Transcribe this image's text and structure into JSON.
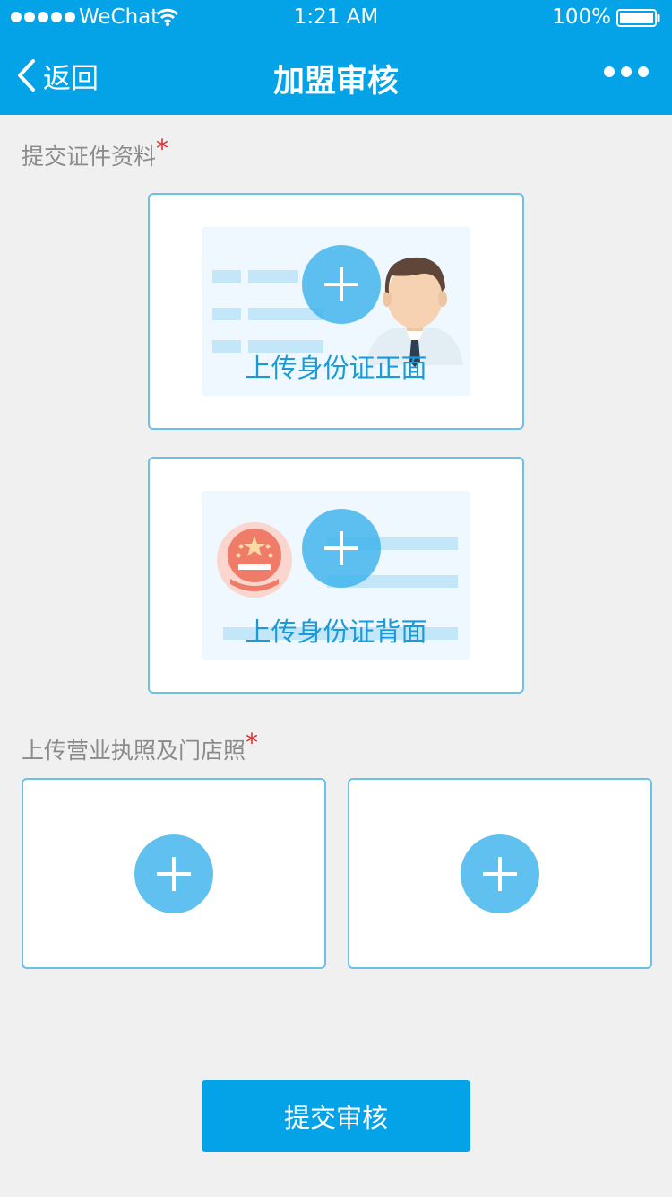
{
  "status_bar": {
    "carrier": "WeChat",
    "time": "1:21 AM",
    "battery": "100%"
  },
  "nav": {
    "back_label": "返回",
    "title": "加盟审核"
  },
  "id_section": {
    "label": "提交证件资料",
    "required_mark": "*",
    "front_caption": "上传身份证正面",
    "back_caption": "上传身份证背面"
  },
  "license_section": {
    "label": "上传营业执照及门店照",
    "required_mark": "*"
  },
  "submit_label": "提交审核",
  "colors": {
    "accent": "#04a3e7",
    "card_border": "#6cc1ea",
    "required": "#e02e2e",
    "background": "#f0f0f0"
  }
}
